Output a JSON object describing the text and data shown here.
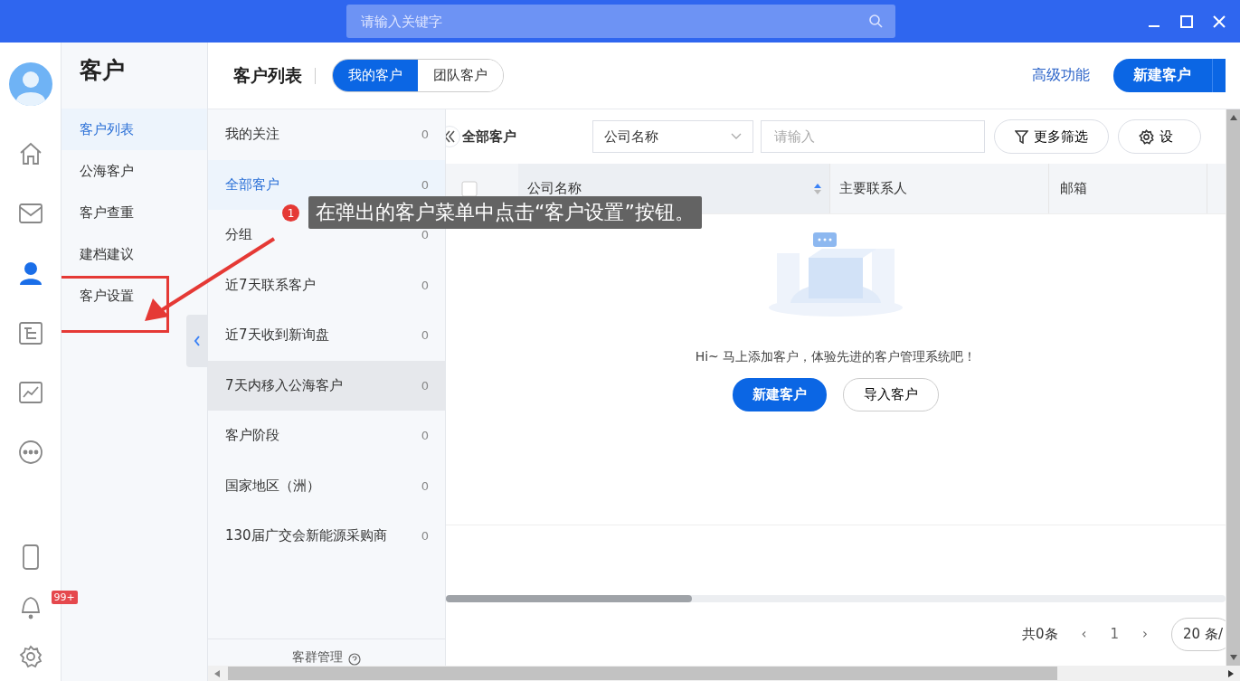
{
  "title_bar": {
    "search_placeholder": "请输入关键字"
  },
  "nav_rail": {
    "items": [
      {
        "kind": "home",
        "selected": false
      },
      {
        "kind": "mail",
        "selected": false
      },
      {
        "kind": "user",
        "selected": true
      },
      {
        "kind": "org",
        "selected": false
      },
      {
        "kind": "chart",
        "selected": false
      },
      {
        "kind": "more",
        "selected": false
      }
    ],
    "bottom_items": [
      {
        "kind": "phone"
      },
      {
        "kind": "bell",
        "badge": "99+"
      },
      {
        "kind": "gear"
      }
    ]
  },
  "module": {
    "title": "客户",
    "items": [
      {
        "label": "客户列表",
        "selected": true
      },
      {
        "label": "公海客户",
        "selected": false
      },
      {
        "label": "客户查重",
        "selected": false
      },
      {
        "label": "建档建议",
        "selected": false
      },
      {
        "label": "客户设置",
        "selected": false
      }
    ]
  },
  "header": {
    "title": "客户列表",
    "tabs": [
      {
        "label": "我的客户",
        "selected": true
      },
      {
        "label": "团队客户",
        "selected": false
      }
    ],
    "link": "高级功能",
    "primary_button": "新建客户"
  },
  "groups": {
    "items": [
      {
        "label": "我的关注",
        "count": "0",
        "selected": false,
        "hovered": false
      },
      {
        "label": "全部客户",
        "count": "0",
        "selected": true,
        "hovered": false
      },
      {
        "label": "分组",
        "count": "0",
        "selected": false,
        "hovered": false
      },
      {
        "label": "近7天联系客户",
        "count": "0",
        "selected": false,
        "hovered": false
      },
      {
        "label": "近7天收到新询盘",
        "count": "0",
        "selected": false,
        "hovered": false
      },
      {
        "label": "7天内移入公海客户",
        "count": "0",
        "selected": false,
        "hovered": true
      },
      {
        "label": "客户阶段",
        "count": "0",
        "selected": false,
        "hovered": false
      },
      {
        "label": "国家地区（洲）",
        "count": "0",
        "selected": false,
        "hovered": false
      },
      {
        "label": "130届广交会新能源采购商",
        "count": "0",
        "selected": false,
        "hovered": false
      }
    ],
    "footer": "客群管理"
  },
  "filter": {
    "title": "全部客户",
    "select": "公司名称",
    "input_placeholder": "请输入",
    "more_button": "更多筛选",
    "settings_button": "设"
  },
  "table": {
    "select_all_checked": false,
    "columns": [
      {
        "label": "公司名称",
        "sortable": true
      },
      {
        "label": "主要联系人",
        "sortable": false
      },
      {
        "label": "邮箱",
        "sortable": false
      }
    ]
  },
  "empty_state": {
    "message": "Hi~ 马上添加客户，体验先进的客户管理系统吧！",
    "primary_button": "新建客户",
    "secondary_button": "导入客户"
  },
  "pagination": {
    "total": "共0条",
    "prev": "‹",
    "page": "1",
    "next": "›",
    "page_size": "20 条/"
  },
  "annotation": {
    "step": "1",
    "text": "在弹出的客户菜单中点击“客户设置”按钮。"
  }
}
